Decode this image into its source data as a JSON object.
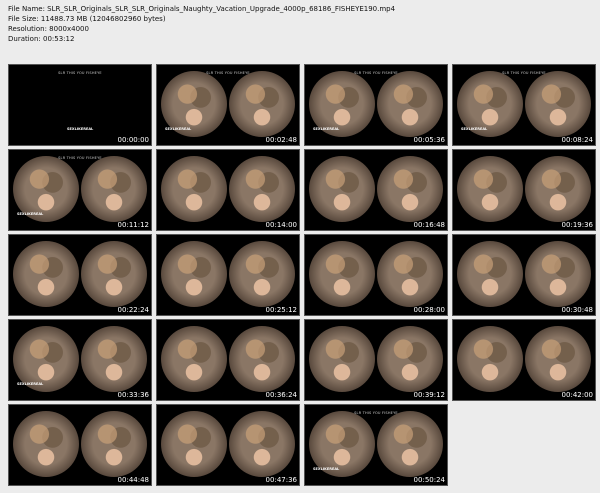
{
  "header": {
    "file_name": "File Name: SLR_SLR_Originals_SLR_SLR_Originals_Naughty_Vacation_Upgrade_4000p_68186_FISHEYE190.mp4",
    "file_size": "File Size: 11488.73 MB (12046802960 bytes)",
    "resolution": "Resolution: 8000x4000",
    "duration": "Duration: 00:53:12"
  },
  "overlay": {
    "title": "SLR THIS YOU FISHEYE",
    "brand": "SEXLIKEREAL"
  },
  "thumbnails": [
    {
      "time": "00:00:00"
    },
    {
      "time": "00:02:48"
    },
    {
      "time": "00:05:36"
    },
    {
      "time": "00:08:24"
    },
    {
      "time": "00:11:12"
    },
    {
      "time": "00:14:00"
    },
    {
      "time": "00:16:48"
    },
    {
      "time": "00:19:36"
    },
    {
      "time": "00:22:24"
    },
    {
      "time": "00:25:12"
    },
    {
      "time": "00:28:00"
    },
    {
      "time": "00:30:48"
    },
    {
      "time": "00:33:36"
    },
    {
      "time": "00:36:24"
    },
    {
      "time": "00:39:12"
    },
    {
      "time": "00:42:00"
    },
    {
      "time": "00:44:48"
    },
    {
      "time": "00:47:36"
    },
    {
      "time": "00:50:24"
    }
  ]
}
